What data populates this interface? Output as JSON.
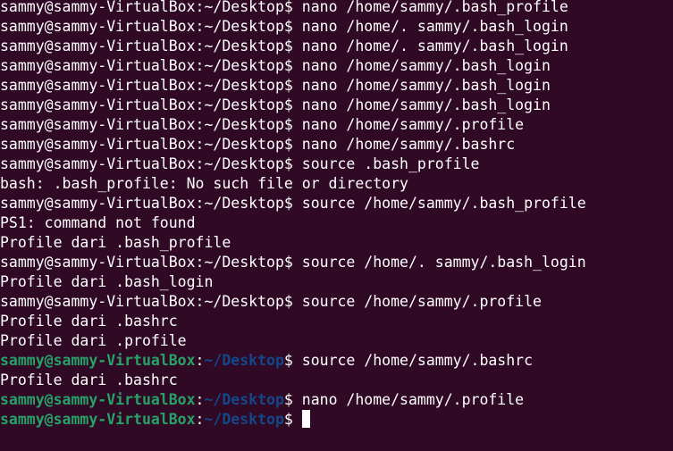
{
  "colors": {
    "background": "#300a24",
    "text": "#ffffff",
    "user_host": "#26a269",
    "path": "#12488b"
  },
  "lines": [
    {
      "type": "prompt_plain",
      "prompt": "sammy@sammy-VirtualBox:~/Desktop$",
      "cmd": " nano /home/sammy/.bash_profile"
    },
    {
      "type": "prompt_plain",
      "prompt": "sammy@sammy-VirtualBox:~/Desktop$",
      "cmd": " nano /home/. sammy/.bash_login"
    },
    {
      "type": "prompt_plain",
      "prompt": "sammy@sammy-VirtualBox:~/Desktop$",
      "cmd": " nano /home/. sammy/.bash_login"
    },
    {
      "type": "prompt_plain",
      "prompt": "sammy@sammy-VirtualBox:~/Desktop$",
      "cmd": " nano /home/sammy/.bash_login"
    },
    {
      "type": "prompt_plain",
      "prompt": "sammy@sammy-VirtualBox:~/Desktop$",
      "cmd": " nano /home/sammy/.bash_login"
    },
    {
      "type": "prompt_plain",
      "prompt": "sammy@sammy-VirtualBox:~/Desktop$",
      "cmd": " nano /home/sammy/.bash_login"
    },
    {
      "type": "prompt_plain",
      "prompt": "sammy@sammy-VirtualBox:~/Desktop$",
      "cmd": " nano /home/sammy/.profile"
    },
    {
      "type": "prompt_plain",
      "prompt": "sammy@sammy-VirtualBox:~/Desktop$",
      "cmd": " nano /home/sammy/.bashrc"
    },
    {
      "type": "prompt_plain",
      "prompt": "sammy@sammy-VirtualBox:~/Desktop$",
      "cmd": " source .bash_profile"
    },
    {
      "type": "output",
      "text": "bash: .bash_profile: No such file or directory"
    },
    {
      "type": "prompt_plain",
      "prompt": "sammy@sammy-VirtualBox:~/Desktop$",
      "cmd": " source /home/sammy/.bash_profile"
    },
    {
      "type": "output",
      "text": "PS1: command not found"
    },
    {
      "type": "output",
      "text": "Profile dari .bash_profile"
    },
    {
      "type": "prompt_plain",
      "prompt": "sammy@sammy-VirtualBox:~/Desktop$",
      "cmd": " source /home/. sammy/.bash_login"
    },
    {
      "type": "output",
      "text": "Profile dari .bash_login"
    },
    {
      "type": "prompt_plain",
      "prompt": "sammy@sammy-VirtualBox:~/Desktop$",
      "cmd": " source /home/sammy/.profile"
    },
    {
      "type": "output",
      "text": "Profile dari .bashrc"
    },
    {
      "type": "output",
      "text": "Profile dari .profile"
    },
    {
      "type": "prompt_color",
      "user": "sammy@sammy-VirtualBox",
      "sep": ":",
      "path": "~/Desktop",
      "dollar": "$",
      "cmd": " source /home/sammy/.bashrc"
    },
    {
      "type": "output",
      "text": "Profile dari .bashrc"
    },
    {
      "type": "prompt_color",
      "user": "sammy@sammy-VirtualBox",
      "sep": ":",
      "path": "~/Desktop",
      "dollar": "$",
      "cmd": " nano /home/sammy/.profile"
    },
    {
      "type": "prompt_color",
      "user": "sammy@sammy-VirtualBox",
      "sep": ":",
      "path": "~/Desktop",
      "dollar": "$",
      "cmd": "",
      "cursor": true
    }
  ]
}
